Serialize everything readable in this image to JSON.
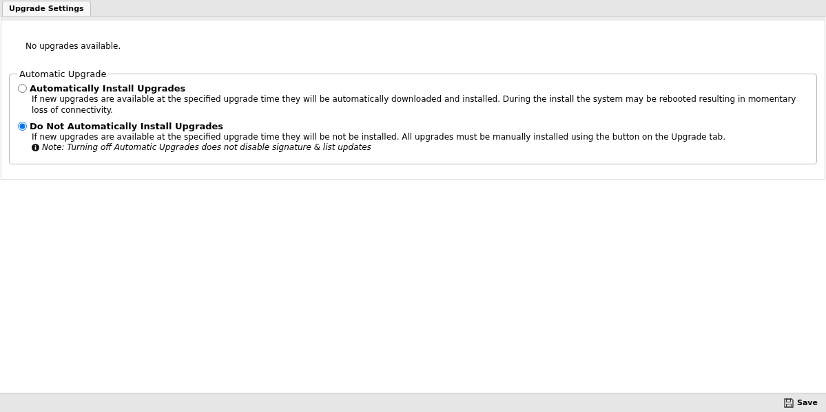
{
  "tabs": [
    {
      "label": "Upgrade Settings",
      "selected": true
    }
  ],
  "status_message": "No upgrades available.",
  "fieldset": {
    "legend": "Automatic Upgrade",
    "options": [
      {
        "label": "Automatically Install Upgrades",
        "selected": false,
        "description": "If new upgrades are available at the specified upgrade time they will be automatically downloaded and installed. During the install the system may be rebooted resulting in momentary loss of connectivity."
      },
      {
        "label": "Do Not Automatically Install Upgrades",
        "selected": true,
        "description": "If new upgrades are available at the specified upgrade time they will be not be installed. All upgrades must be manually installed using the button on the Upgrade tab.",
        "note": "Note: Turning off Automatic Upgrades does not disable signature & list updates"
      }
    ]
  },
  "buttons": [
    {
      "label": "Save"
    }
  ]
}
